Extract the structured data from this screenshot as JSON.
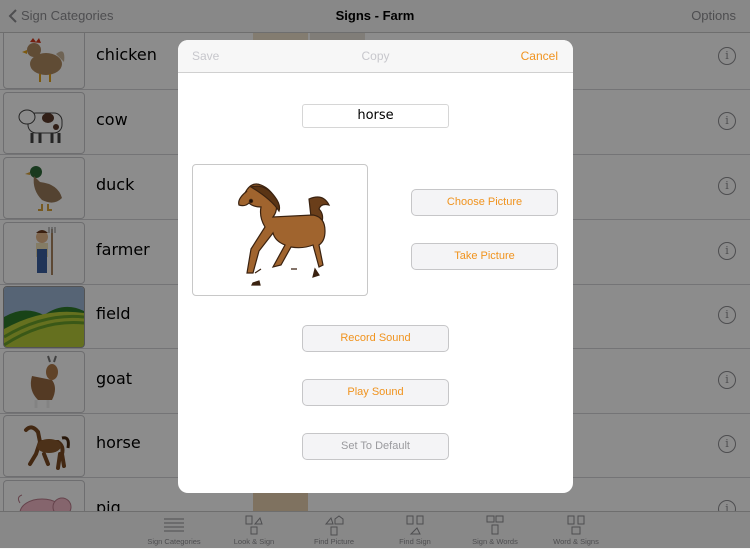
{
  "navbar": {
    "back_label": "Sign Categories",
    "title": "Signs - Farm",
    "options_label": "Options"
  },
  "list": {
    "items": [
      {
        "label": "chicken",
        "icon": "chicken-picture"
      },
      {
        "label": "cow",
        "icon": "cow-picture"
      },
      {
        "label": "duck",
        "icon": "duck-picture"
      },
      {
        "label": "farmer",
        "icon": "farmer-picture"
      },
      {
        "label": "field",
        "icon": "field-picture"
      },
      {
        "label": "goat",
        "icon": "goat-picture"
      },
      {
        "label": "horse",
        "icon": "horse-picture"
      },
      {
        "label": "pig",
        "icon": "pig-picture"
      }
    ],
    "info_glyph": "i"
  },
  "tabbar": {
    "tabs": [
      {
        "label": "Sign Categories",
        "icon": "list-icon"
      },
      {
        "label": "Look & Sign",
        "icon": "look-sign-icon"
      },
      {
        "label": "Find Picture",
        "icon": "find-picture-icon"
      },
      {
        "label": "Find Sign",
        "icon": "find-sign-icon"
      },
      {
        "label": "Sign & Words",
        "icon": "sign-words-icon"
      },
      {
        "label": "Word & Signs",
        "icon": "word-signs-icon"
      }
    ]
  },
  "modal": {
    "save_label": "Save",
    "copy_label": "Copy",
    "cancel_label": "Cancel",
    "name_value": "horse",
    "choose_picture_label": "Choose Picture",
    "take_picture_label": "Take Picture",
    "record_sound_label": "Record Sound",
    "play_sound_label": "Play Sound",
    "set_default_label": "Set To Default"
  },
  "colors": {
    "accent": "#f0931e",
    "disabled": "#c7c7cc",
    "overlay": "rgba(0,0,0,0.45)"
  }
}
